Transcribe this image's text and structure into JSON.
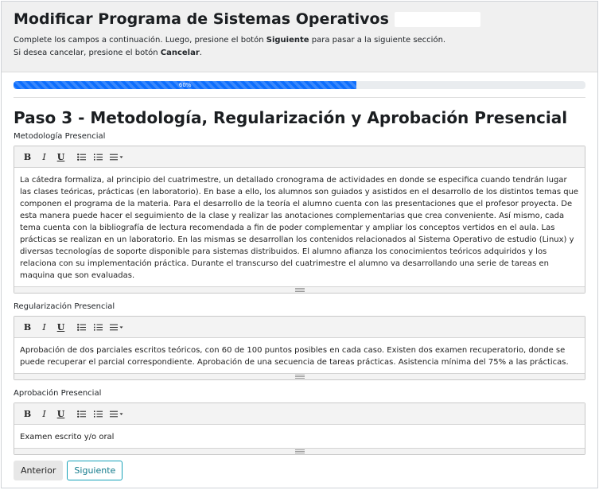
{
  "header": {
    "title": "Modificar Programa de Sistemas Operativos",
    "line1_prefix": "Complete los campos a continuación. Luego, presione el botón ",
    "line1_bold": "Siguiente",
    "line1_suffix": " para pasar a la siguiente sección.",
    "line2_prefix": "Si desea cancelar, presione el botón ",
    "line2_bold": "Cancelar",
    "line2_suffix": "."
  },
  "progress": {
    "value": 0.6,
    "label": "60%",
    "color": "#0d6efd"
  },
  "step": {
    "title": "Paso 3 - Metodología, Regularización y Aprobación Presencial"
  },
  "toolbar": {
    "bold": "B",
    "italic": "I",
    "underline": "U"
  },
  "fields": [
    {
      "label": "Metodología Presencial",
      "text": "La cátedra formaliza, al principio del cuatrimestre, un detallado cronograma de actividades en donde se especifica cuando tendrán lugar las clases teóricas, prácticas (en laboratorio). En base a ello, los alumnos son guiados y asistidos en el desarrollo de los distintos temas que componen el programa de la materia. Para el desarrollo de la teoría el alumno cuenta con las presentaciones que el profesor proyecta. De esta manera puede hacer el seguimiento de la clase y realizar las anotaciones complementarias que crea conveniente. Así mismo, cada tema cuenta con la bibliografía de lectura recomendada a fin de poder complementar y ampliar los conceptos vertidos en el aula. Las prácticas se realizan en un laboratorio. En las mismas se desarrollan los contenidos relacionados al Sistema Operativo de estudio (Linux) y diversas tecnologías de soporte disponible para sistemas distribuidos. El alumno afianza los conocimientos teóricos adquiridos y los relaciona con su implementación práctica. Durante el transcurso del cuatrimestre el alumno va desarrollando una serie de tareas en maquina que son evaluadas."
    },
    {
      "label": "Regularización Presencial",
      "text": "Aprobación de dos parciales escritos teóricos, con 60 de 100 puntos posibles en cada caso. Existen dos examen recuperatorio, donde se puede recuperar el parcial correspondiente. Aprobación de una secuencia de tareas prácticas. Asistencia mínima del 75% a las prácticas."
    },
    {
      "label": "Aprobación Presencial",
      "text": "Examen escrito y/o oral"
    }
  ],
  "buttons": {
    "back": "Anterior",
    "next": "Siguiente"
  }
}
